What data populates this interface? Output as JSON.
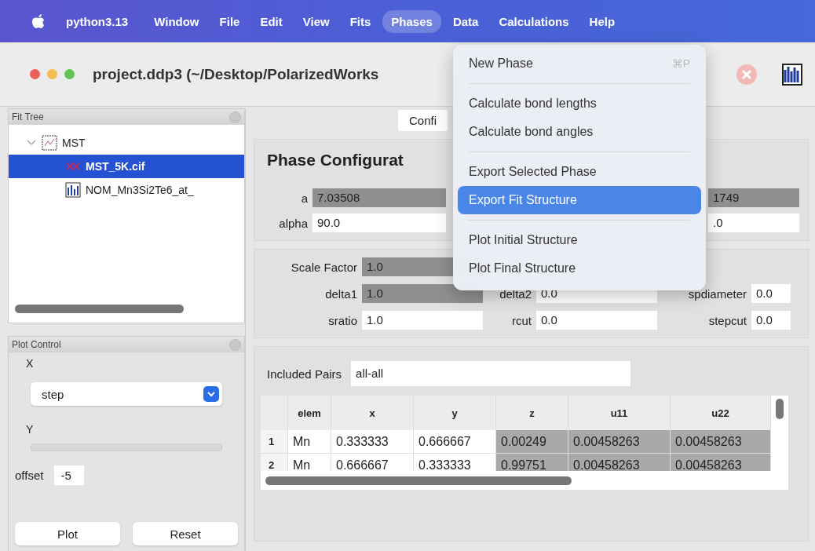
{
  "menubar": {
    "app": "python3.13",
    "items": [
      {
        "label": "Window",
        "selected": false
      },
      {
        "label": "File",
        "selected": false
      },
      {
        "label": "Edit",
        "selected": false
      },
      {
        "label": "View",
        "selected": false
      },
      {
        "label": "Fits",
        "selected": false
      },
      {
        "label": "Phases",
        "selected": true
      },
      {
        "label": "Data",
        "selected": false
      },
      {
        "label": "Calculations",
        "selected": false
      },
      {
        "label": "Help",
        "selected": false
      }
    ]
  },
  "window": {
    "title": "project.ddp3 (~/Desktop/PolarizedWorks"
  },
  "menu": {
    "items": [
      {
        "kind": "item",
        "label": "New Phase",
        "shortcut": "⌘P",
        "selected": false
      },
      {
        "kind": "separator"
      },
      {
        "kind": "item",
        "label": "Calculate bond lengths",
        "selected": false
      },
      {
        "kind": "item",
        "label": "Calculate bond angles",
        "selected": false
      },
      {
        "kind": "separator"
      },
      {
        "kind": "item",
        "label": "Export Selected Phase",
        "selected": false
      },
      {
        "kind": "item",
        "label": "Export Fit Structure",
        "selected": true
      },
      {
        "kind": "separator"
      },
      {
        "kind": "item",
        "label": "Plot Initial Structure",
        "selected": false
      },
      {
        "kind": "item",
        "label": "Plot Final Structure",
        "selected": false
      }
    ]
  },
  "fit_tree": {
    "title": "Fit Tree",
    "items": [
      {
        "label": "MST",
        "kind": "fit",
        "expanded": true,
        "selected": false,
        "children": [
          {
            "label": "MST_5K.cif",
            "kind": "phase",
            "selected": true
          },
          {
            "label": "NOM_Mn3Si2Te6_at_",
            "kind": "data",
            "selected": false
          }
        ]
      }
    ]
  },
  "plot_control": {
    "title": "Plot Control",
    "x_label": "X",
    "x_value": "step",
    "y_label": "Y",
    "offset_label": "offset",
    "offset_value": "-5",
    "buttons": [
      "Plot",
      "Reset"
    ]
  },
  "tab": {
    "label": "Confi"
  },
  "phase_config": {
    "title": "Phase Configurat",
    "lattice": [
      [
        {
          "label": "a",
          "value": "7.03508",
          "refined": true
        },
        {
          "value": "1749",
          "refined": true
        }
      ],
      [
        {
          "label": "alpha",
          "value": "90.0",
          "refined": false
        },
        {
          "value": ".0",
          "refined": false
        }
      ]
    ],
    "scale": {
      "label": "Scale Factor",
      "value": "1.0",
      "refined": true
    },
    "params": [
      [
        {
          "label": "delta1",
          "value": "1.0",
          "refined": true
        },
        {
          "label": "delta2",
          "value": "0.0",
          "refined": false
        },
        {
          "label": "spdiameter",
          "value": "0.0",
          "refined": false
        }
      ],
      [
        {
          "label": "sratio",
          "value": "1.0",
          "refined": false
        },
        {
          "label": "rcut",
          "value": "0.0",
          "refined": false
        },
        {
          "label": "stepcut",
          "value": "0.0",
          "refined": false
        }
      ]
    ],
    "pairs": {
      "label": "Included Pairs",
      "value": "all-all"
    },
    "table": {
      "columns": [
        {
          "label": "elem",
          "refined": false
        },
        {
          "label": "x",
          "refined": false
        },
        {
          "label": "y",
          "refined": false
        },
        {
          "label": "z",
          "refined": true
        },
        {
          "label": "u11",
          "refined": true
        },
        {
          "label": "u22",
          "refined": true
        }
      ],
      "rows": [
        {
          "index": "1",
          "cells": [
            "Mn",
            "0.333333",
            "0.666667",
            "0.00249",
            "0.00458263",
            "0.00458263"
          ]
        },
        {
          "index": "2",
          "cells": [
            "Mn",
            "0.666667",
            "0.333333",
            "0.99751",
            "0.00458263",
            "0.00458263"
          ]
        }
      ]
    }
  }
}
